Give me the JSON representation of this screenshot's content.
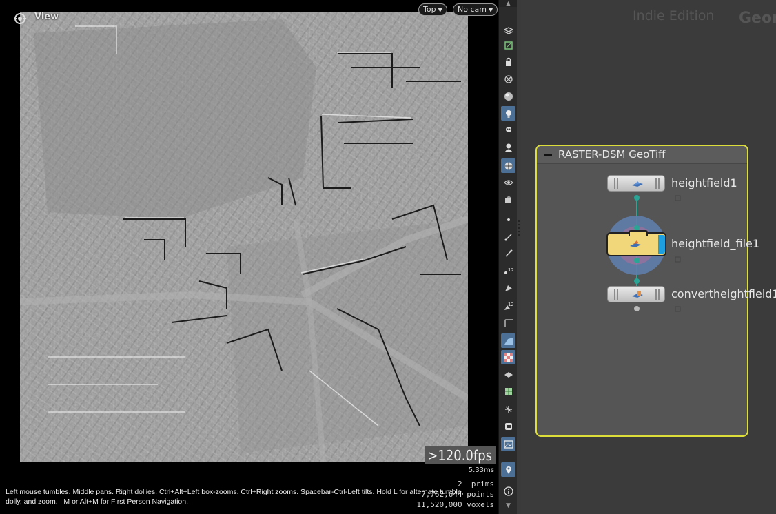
{
  "viewport": {
    "title": "View",
    "view_dropdown": "Top",
    "camera_dropdown": "No cam",
    "fps": ">120.0fps",
    "frame_time": "5.33ms",
    "stats": {
      "prims": "2  prims",
      "points": "7,762,644 points",
      "voxels": "11,520,000 voxels"
    },
    "help_line_1": "Left mouse tumbles. Middle pans. Right dollies. Ctrl+Alt+Left box-zooms. Ctrl+Right zooms. Spacebar-Ctrl-Left tilts. Hold L for alternate tumble,",
    "help_line_2": "dolly, and zoom.   M or Alt+M for First Person Navigation."
  },
  "toolbar": {
    "icons": [
      "display-options-icon",
      "ghost-other-objects-icon",
      "lock-camera-icon",
      "hide-other-objects-icon",
      "shading-mode-icon",
      "light-icon",
      "headlight-icon",
      "head-icon",
      "snapshot-icon",
      "visibility-icon",
      "display-vis-icon",
      "point-icon",
      "normal-icon",
      "point-normal-icon",
      "point-numbers-icon",
      "prim-icon",
      "prim-numbers-icon",
      "axis-icon",
      "background-icon",
      "checker-icon",
      "layers-icon",
      "uv-icon",
      "scale-icon",
      "safe-area-icon",
      "render-region-icon",
      "pin-icon",
      "info-icon"
    ]
  },
  "network": {
    "edition": "Indie Edition",
    "context": "Geom",
    "netbox_title": "RASTER-DSM GeoTiff",
    "nodes": [
      {
        "name": "heightfield1"
      },
      {
        "name": "heightfield_file1"
      },
      {
        "name": "convertheightfield1"
      }
    ]
  },
  "colors": {
    "netbox_border": "#dede3a",
    "wire": "#2aa495",
    "selected_node": "#f2d67a",
    "display_flag": "#1e9fe0"
  }
}
